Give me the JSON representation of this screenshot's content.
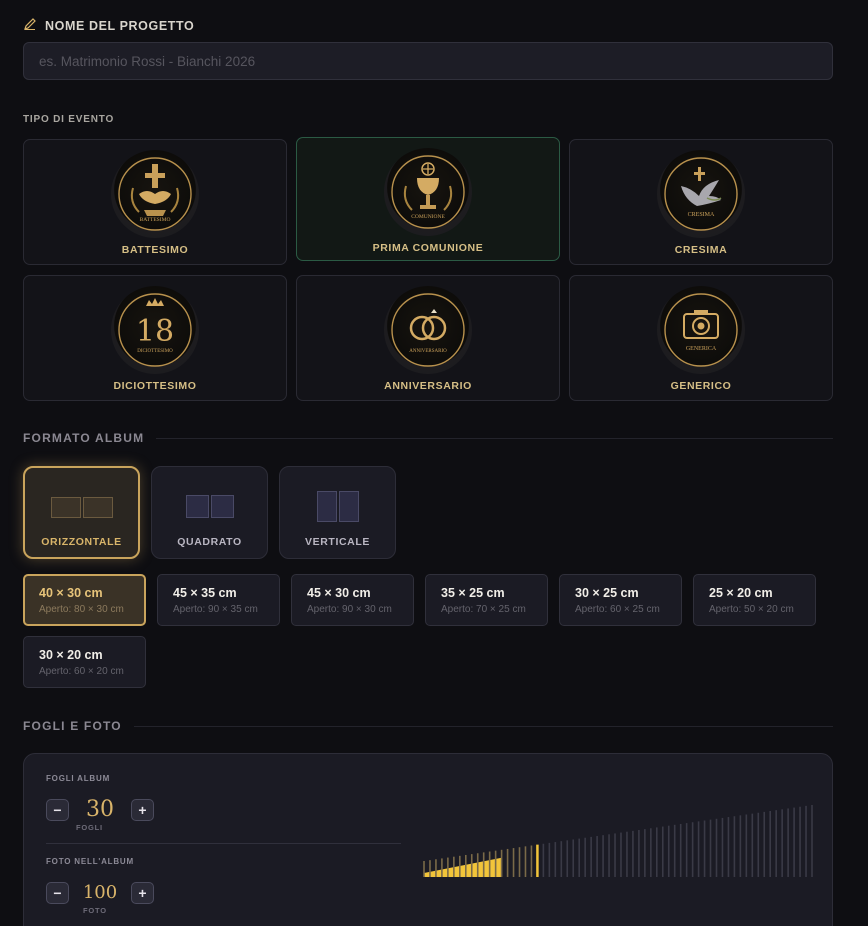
{
  "project": {
    "label": "NOME DEL PROGETTO",
    "placeholder": "es. Matrimonio Rossi - Bianchi 2026",
    "value": ""
  },
  "event_type": {
    "label": "TIPO DI EVENTO",
    "selected": "PRIMA COMUNIONE",
    "items": [
      {
        "name": "BATTESIMO",
        "medal_text": "BATTESIMO",
        "icon": "dove-cross-icon"
      },
      {
        "name": "PRIMA COMUNIONE",
        "medal_text": "COMUNIONE",
        "icon": "chalice-icon"
      },
      {
        "name": "CRESIMA",
        "medal_text": "CRESIMA",
        "icon": "dove-cross-icon"
      },
      {
        "name": "DICIOTTESIMO",
        "medal_text": "DICIOTTESIMO",
        "big_number": "18",
        "icon": "crown-18-icon"
      },
      {
        "name": "ANNIVERSARIO",
        "medal_text": "ANNIVERSARIO",
        "icon": "rings-icon"
      },
      {
        "name": "GENERICO",
        "medal_text": "GENERICA",
        "icon": "camera-icon"
      }
    ]
  },
  "album_format": {
    "label": "FORMATO ALBUM",
    "selected": "ORIZZONTALE",
    "orientations": [
      {
        "name": "ORIZZONTALE"
      },
      {
        "name": "QUADRATO"
      },
      {
        "name": "VERTICALE"
      }
    ],
    "selected_size": "40 × 30 cm",
    "sizes": [
      {
        "size": "40 × 30 cm",
        "open": "Aperto: 80 × 30 cm"
      },
      {
        "size": "45 × 35 cm",
        "open": "Aperto: 90 × 35 cm"
      },
      {
        "size": "45 × 30 cm",
        "open": "Aperto: 90 × 30 cm"
      },
      {
        "size": "35 × 25 cm",
        "open": "Aperto: 70 × 25 cm"
      },
      {
        "size": "30 × 25 cm",
        "open": "Aperto: 60 × 25 cm"
      },
      {
        "size": "25 × 20 cm",
        "open": "Aperto: 50 × 20 cm"
      },
      {
        "size": "30 × 20 cm",
        "open": "Aperto: 60 × 20 cm"
      }
    ]
  },
  "sheets_photos": {
    "label": "FOGLI E FOTO",
    "sheets": {
      "label": "FOGLI ALBUM",
      "value": "30",
      "unit": "FOGLI",
      "minus": "−",
      "plus": "+"
    },
    "photos": {
      "label": "FOTO NELL'ALBUM",
      "value": "100",
      "unit": "FOTO",
      "minus": "−",
      "plus": "+"
    },
    "slider_total_bars": 66,
    "slider_level": 0.293
  },
  "colors": {
    "gold": "#d9b46a",
    "accent_fill": "#f2c53a",
    "selected_event_border": "#2b5a44"
  }
}
